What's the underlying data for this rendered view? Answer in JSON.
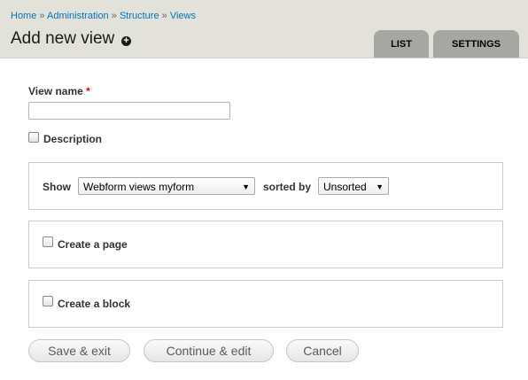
{
  "breadcrumb": {
    "items": [
      "Home",
      "Administration",
      "Structure",
      "Views"
    ],
    "separator": "»"
  },
  "header": {
    "title": "Add new view",
    "shortcut_icon": "plus-circle-icon"
  },
  "tabs": [
    {
      "label": "LIST"
    },
    {
      "label": "SETTINGS"
    }
  ],
  "form": {
    "view_name": {
      "label": "View name",
      "required_marker": "*",
      "value": ""
    },
    "description": {
      "label": "Description",
      "checked": false
    },
    "show": {
      "label": "Show",
      "selected": "Webform views myform",
      "sorted_label": "sorted by",
      "sort_selected": "Unsorted"
    },
    "create_page": {
      "label": "Create a page",
      "checked": false
    },
    "create_block": {
      "label": "Create a block",
      "checked": false
    }
  },
  "buttons": {
    "save_exit": "Save & exit",
    "continue_edit": "Continue & edit",
    "cancel": "Cancel"
  },
  "colors": {
    "header_bg": "#e2e2da",
    "tab_bg": "#a6a7a2",
    "link": "#0074bd",
    "required": "#ee0000"
  }
}
